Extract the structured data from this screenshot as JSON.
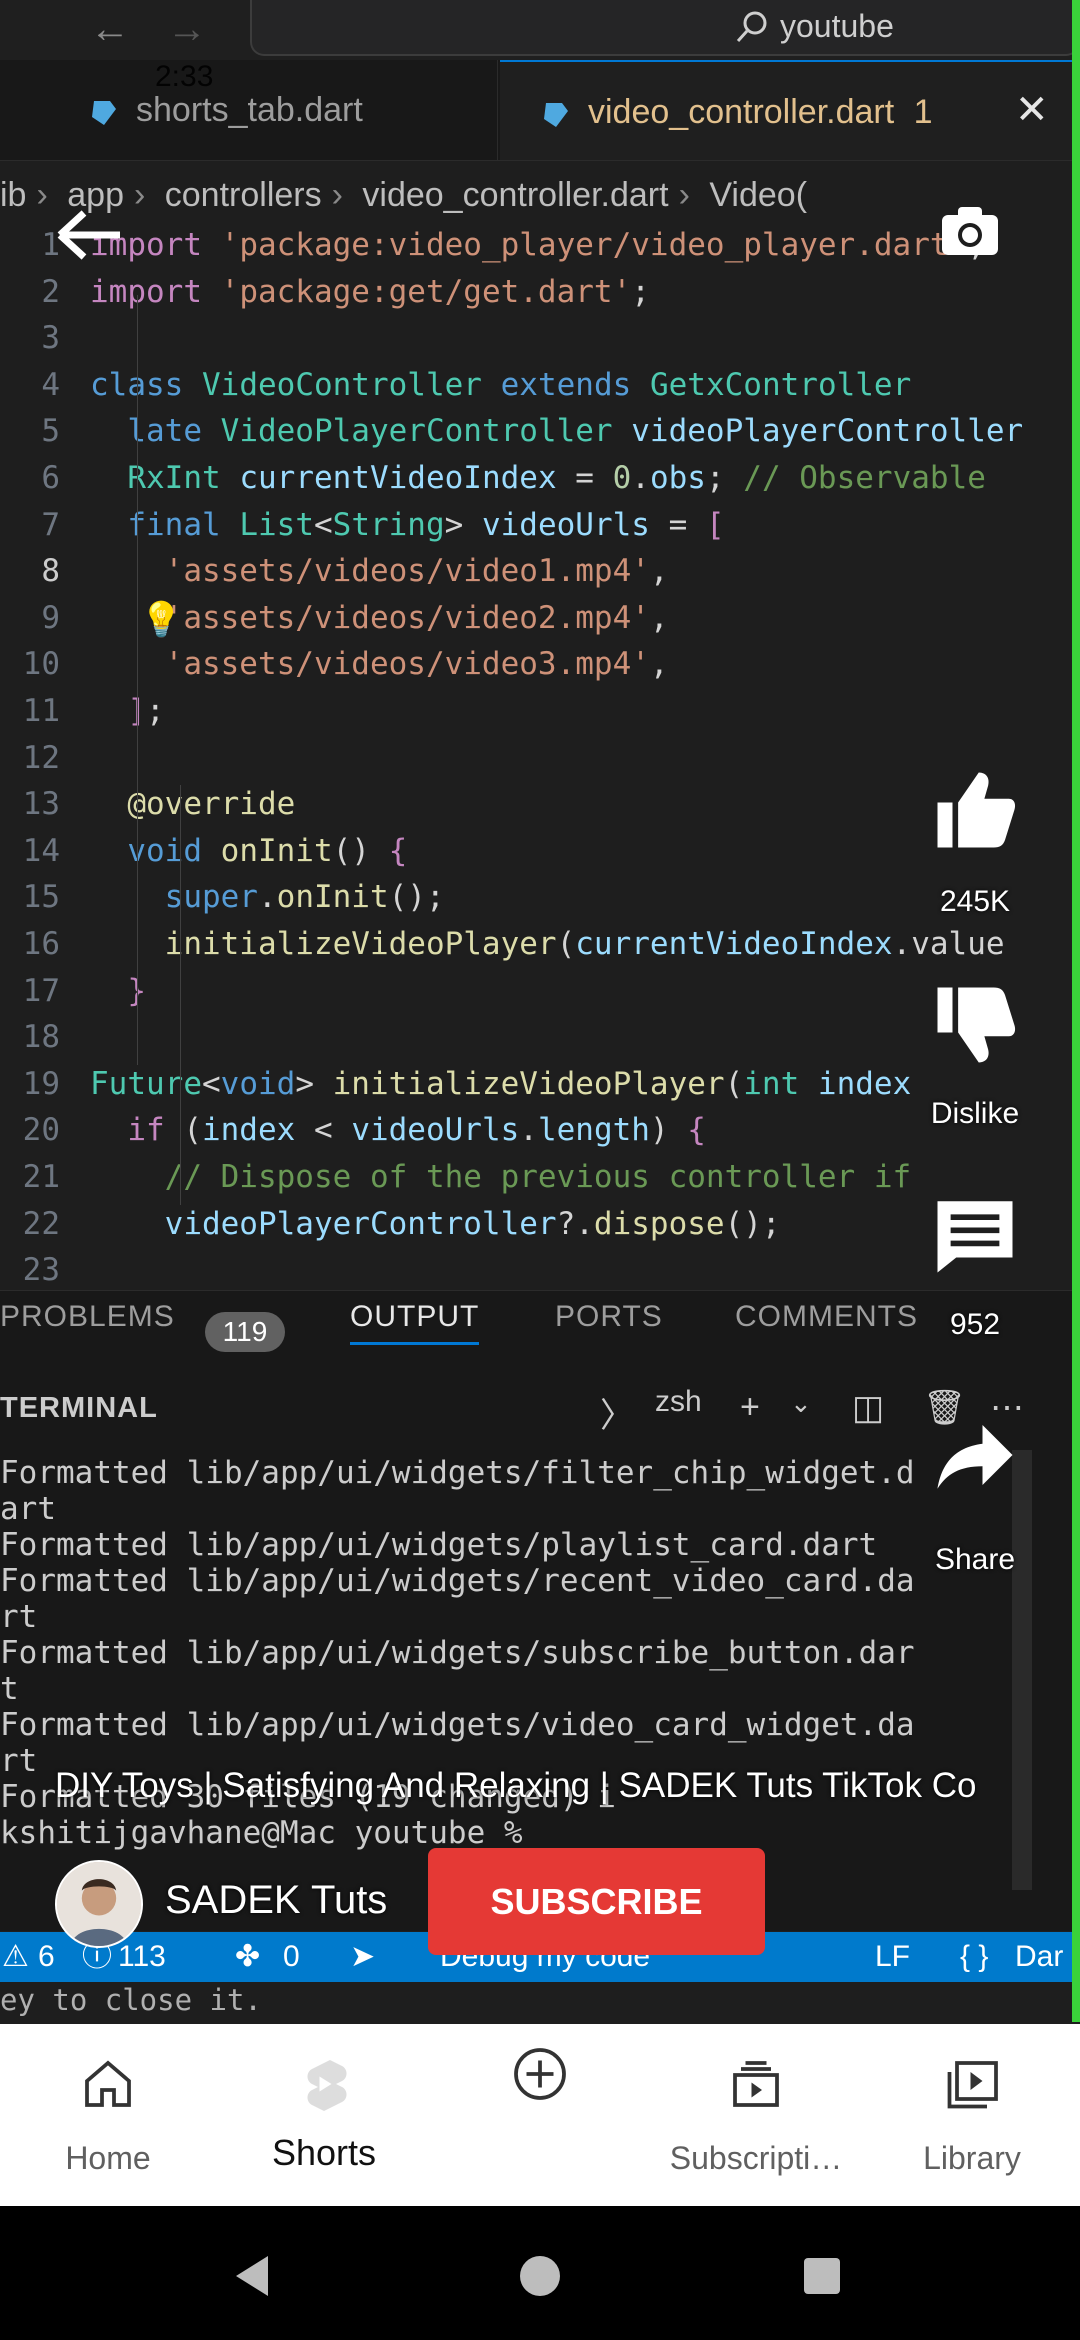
{
  "browser": {
    "address_text": "youtube",
    "back_icon": "arrow-left-icon",
    "forward_icon": "arrow-right-icon"
  },
  "phone_status": {
    "time": "2:33"
  },
  "editor_tabs": [
    {
      "label": "shorts_tab.dart",
      "active": false
    },
    {
      "label": "video_controller.dart",
      "badge": "1",
      "active": true
    }
  ],
  "breadcrumb": [
    "ib",
    "app",
    "controllers",
    "video_controller.dart",
    "Video("
  ],
  "code_lines": [
    {
      "n": "1",
      "html": "<span class='kw2'>import</span> <span class='str'>'package:video_player/video_player.dart'</span>;"
    },
    {
      "n": "2",
      "html": "<span class='kw2'>import</span> <span class='str'>'package:get/get.dart'</span>;"
    },
    {
      "n": "3",
      "html": ""
    },
    {
      "n": "4",
      "html": "<span class='kw'>class</span> <span class='cls'>VideoController</span> <span class='kw'>extends</span> <span class='cls'>GetxController</span>"
    },
    {
      "n": "5",
      "html": "  <span class='kw'>late</span> <span class='cls'>VideoPlayerController</span> <span class='var'>videoPlayerController</span>"
    },
    {
      "n": "6",
      "html": "  <span class='cls'>RxInt</span> <span class='var'>currentVideoIndex</span> = <span class='num'>0</span>.<span class='var'>obs</span>; <span class='cmt'>// Observable</span>"
    },
    {
      "n": "7",
      "html": "  <span class='kw'>final</span> <span class='cls'>List</span>&lt;<span class='cls'>String</span>&gt; <span class='var'>videoUrls</span> = <span class='kw2'>[</span>"
    },
    {
      "n": "8",
      "html": "    <span class='str'>'assets/videos/video1.mp4'</span>,"
    },
    {
      "n": "9",
      "html": "    <span class='str'>'assets/videos/video2.mp4'</span>,"
    },
    {
      "n": "10",
      "html": "    <span class='str'>'assets/videos/video3.mp4'</span>,"
    },
    {
      "n": "11",
      "html": "  <span class='kw2'>]</span>;"
    },
    {
      "n": "12",
      "html": ""
    },
    {
      "n": "13",
      "html": "  <span class='fn'>@override</span>"
    },
    {
      "n": "14",
      "html": "  <span class='kw'>void</span> <span class='fn'>onInit</span>() <span class='kw2'>{</span>"
    },
    {
      "n": "15",
      "html": "    <span class='kw'>super</span>.<span class='fn'>onInit</span>();"
    },
    {
      "n": "16",
      "html": "    <span class='fn'>initializeVideoPlayer</span>(<span class='var'>currentVideoIndex</span>.value"
    },
    {
      "n": "17",
      "html": "  <span class='kw2'>}</span>"
    },
    {
      "n": "18",
      "html": ""
    },
    {
      "n": "19",
      "html": "<span class='cls'>Future</span>&lt;<span class='kw'>void</span>&gt; <span class='fn'>initializeVideoPlayer</span>(<span class='cls'>int</span> <span class='var'>index</span>"
    },
    {
      "n": "20",
      "html": "  <span class='kw2'>if</span> (<span class='var'>index</span> &lt; <span class='var'>videoUrls</span>.<span class='var'>length</span>) <span class='kw2'>{</span>"
    },
    {
      "n": "21",
      "html": "    <span class='cmt'>// Dispose of the previous controller if</span>"
    },
    {
      "n": "22",
      "html": "    <span class='var'>videoPlayerController</span>?.<span class='fn'>dispose</span>();"
    },
    {
      "n": "23",
      "html": ""
    }
  ],
  "panel": {
    "tabs": [
      "PROBLEMS",
      "OUTPUT",
      "PORTS",
      "COMMENTS"
    ],
    "problems_count": "119",
    "terminal_title": "TERMINAL",
    "shell": "zsh",
    "terminal_output": "Formatted lib/app/ui/widgets/filter_chip_widget.d\nart\nFormatted lib/app/ui/widgets/playlist_card.dart\nFormatted lib/app/ui/widgets/recent_video_card.da\nrt\nFormatted lib/app/ui/widgets/subscribe_button.dar\nt\nFormatted lib/app/ui/widgets/video_card_widget.da\nrt\nFormatted 30 files (19 changed) i\nkshitijgavhane@Mac youtube % "
  },
  "statusbar": {
    "warnings": "6",
    "infos": "113",
    "ports": "0",
    "debug": "Debug my code",
    "eol": "LF",
    "lang": "Dar"
  },
  "below_status_text": "ey to close it.",
  "shorts": {
    "like_count": "245K",
    "dislike_label": "Dislike",
    "comment_count": "952",
    "share_label": "Share",
    "video_title": "DIY Toys | Satisfying And Relaxing | SADEK Tuts TikTok Co",
    "channel_name": "SADEK Tuts",
    "subscribe_label": "SUBSCRIBE"
  },
  "bottom_nav": [
    {
      "label": "Home",
      "icon": "home-icon"
    },
    {
      "label": "Shorts",
      "icon": "shorts-icon",
      "active": true
    },
    {
      "label": "",
      "icon": "create-plus-icon"
    },
    {
      "label": "Subscripti…",
      "icon": "subscriptions-icon"
    },
    {
      "label": "Library",
      "icon": "library-icon"
    }
  ],
  "colors": {
    "accent_blue": "#007acc",
    "subscribe_red": "#e53935",
    "edge_green": "#3ad23a"
  }
}
